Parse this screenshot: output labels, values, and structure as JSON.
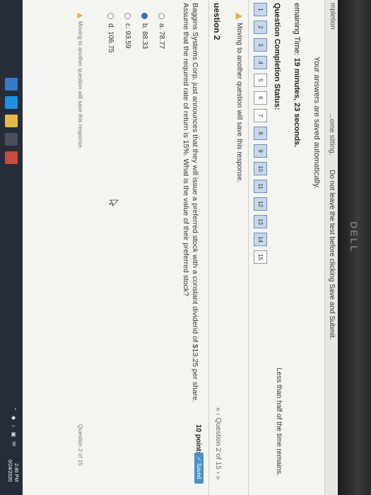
{
  "header": {
    "top_left": "mpletion",
    "warning": "Do not leave the test before clicking Save and Submit.",
    "warning_prefix": "...ome sitting."
  },
  "saved_message": "Your answers are saved automatically.",
  "timer": {
    "label": "emaining Time:",
    "value": "19 minutes, 23 seconds."
  },
  "completion": {
    "label": "Question Completion Status:",
    "time_note": "Less than half of the time remains.",
    "questions": [
      {
        "label": "1",
        "answered": true
      },
      {
        "label": "2",
        "answered": true
      },
      {
        "label": "3",
        "answered": true
      },
      {
        "label": "4",
        "answered": true
      },
      {
        "label": "5",
        "answered": false
      },
      {
        "label": "6",
        "answered": false
      },
      {
        "label": "7",
        "answered": false
      },
      {
        "label": "8",
        "answered": true
      },
      {
        "label": "9",
        "answered": true
      },
      {
        "label": "10",
        "answered": true
      },
      {
        "label": "11",
        "answered": true
      },
      {
        "label": "12",
        "answered": true
      },
      {
        "label": "13",
        "answered": true
      },
      {
        "label": "14",
        "answered": true
      },
      {
        "label": "15",
        "answered": false
      }
    ]
  },
  "move_note": "Moving to another question will save this response.",
  "question": {
    "heading": "uestion 2",
    "nav": "« ‹ Question 2 of 15 › »",
    "points": "10 points",
    "saved_badge": "✓ Saved",
    "text": "Baggins Systems Corp. just announces that they will issue a preferred stock with a constant dividend of $13.25 per share. Assume that the required rate of return is 15%. What is the value of their preferred stock?",
    "options": [
      {
        "label": "a. 78.77",
        "selected": false
      },
      {
        "label": "b. 88.33",
        "selected": true
      },
      {
        "label": "c. 93.59",
        "selected": false
      },
      {
        "label": "d. 106.75",
        "selected": false
      }
    ]
  },
  "footer": {
    "move_note": "Moving to another question will save this response.",
    "nav": "Question 2 of 15"
  },
  "taskbar": {
    "time": "2:46 PM",
    "date": "6/24/2020"
  },
  "monitor_brand": "DELL",
  "colors": {
    "answered": "#c8d8ea",
    "selected_radio": "#3a6fb0",
    "saved_badge": "#4f8fc7",
    "taskbar": "#262d38"
  }
}
